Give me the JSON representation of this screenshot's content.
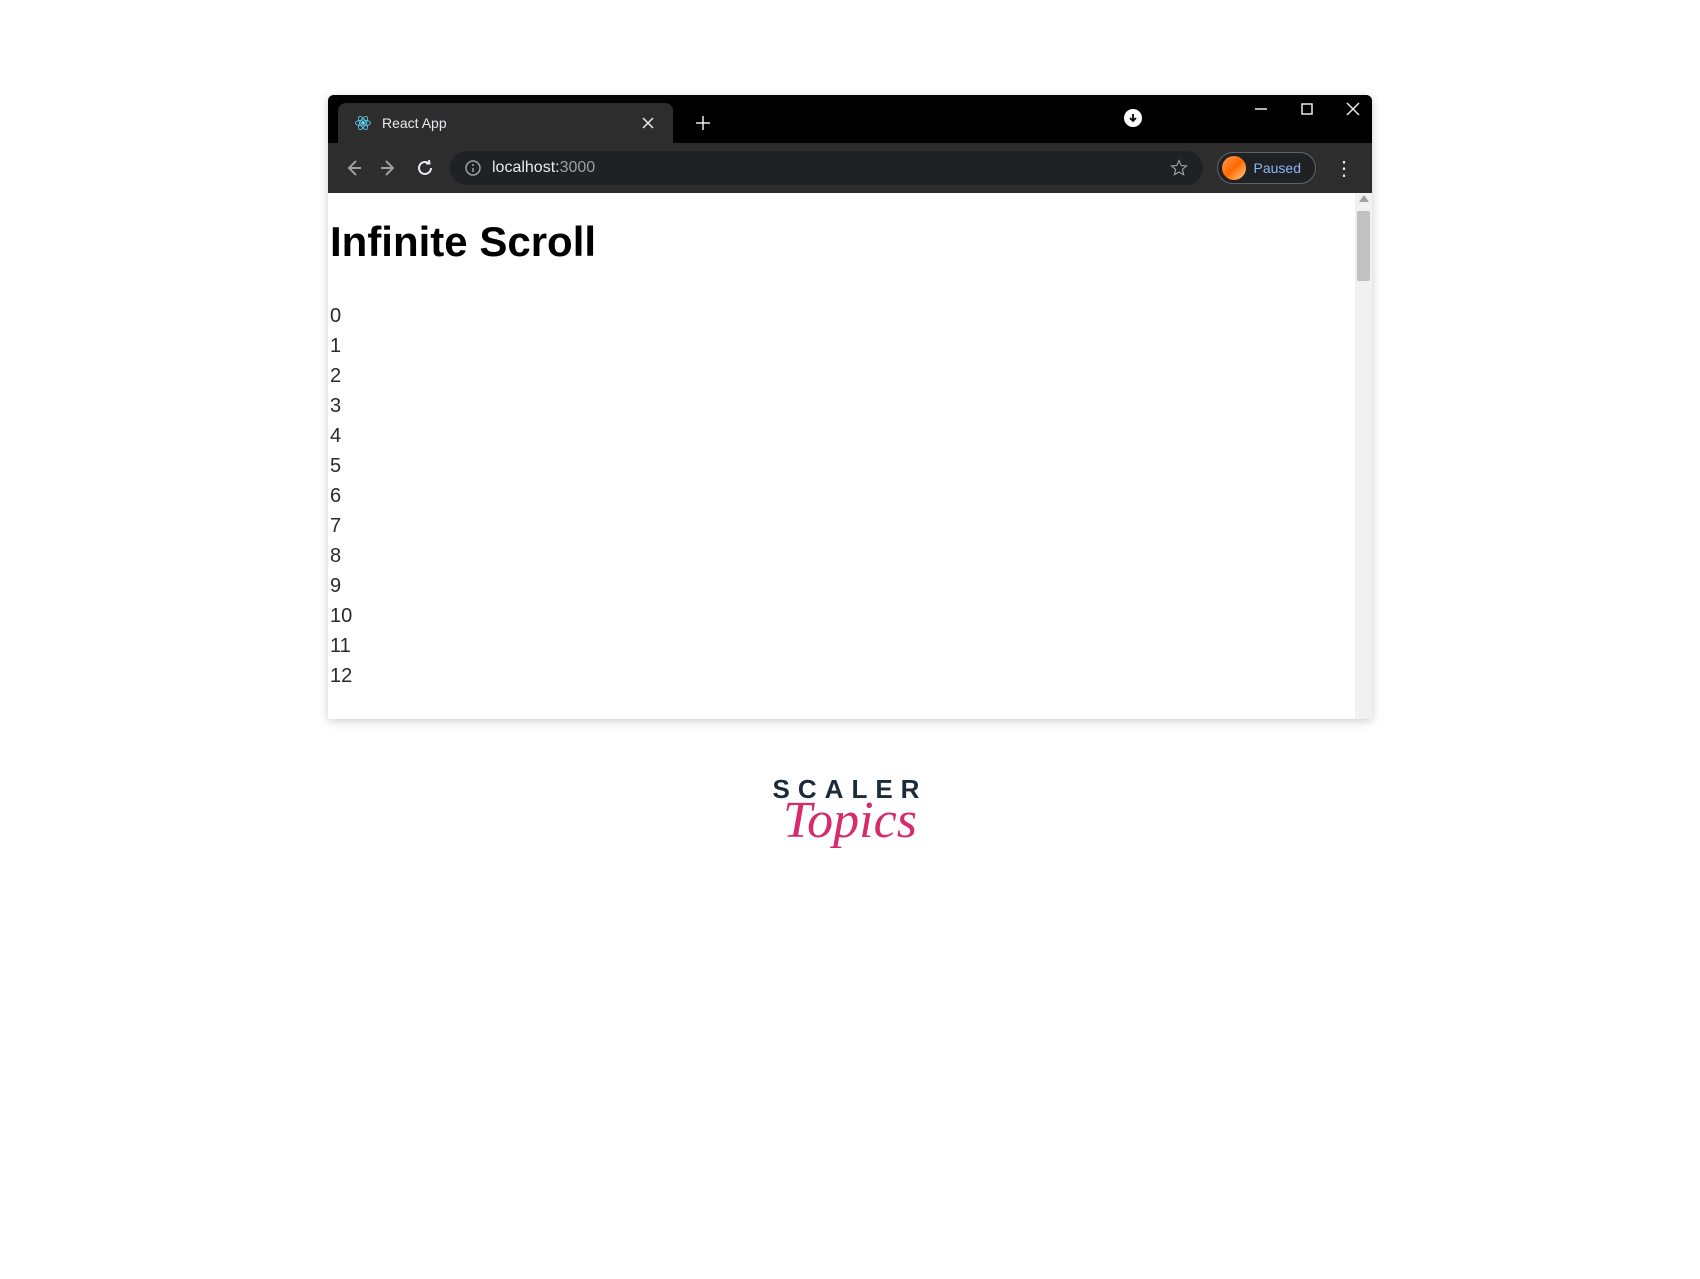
{
  "tab": {
    "title": "React App"
  },
  "address": {
    "host": "localhost:",
    "port": "3000"
  },
  "profile": {
    "label": "Paused"
  },
  "page": {
    "heading": "Infinite Scroll",
    "items": [
      "0",
      "1",
      "2",
      "3",
      "4",
      "5",
      "6",
      "7",
      "8",
      "9",
      "10",
      "11",
      "12"
    ]
  },
  "watermark": {
    "line1": "SCALER",
    "line2": "Topics"
  }
}
